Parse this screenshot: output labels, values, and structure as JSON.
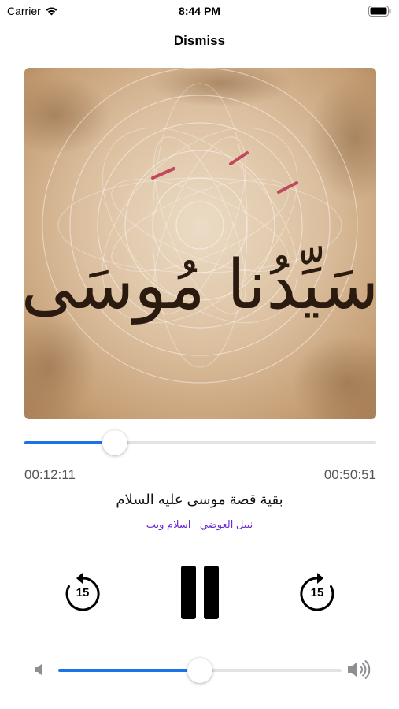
{
  "status_bar": {
    "carrier": "Carrier",
    "time": "8:44 PM"
  },
  "header": {
    "dismiss_label": "Dismiss"
  },
  "artwork": {
    "calligraphy_text": "سَيِّدُنا مُوسَى"
  },
  "playback": {
    "elapsed": "00:12:11",
    "duration": "00:50:51",
    "progress_fraction": 0.257
  },
  "track": {
    "title": "بقية قصة موسى عليه السلام",
    "subtitle": "نبيل العوضي - اسلام ويب",
    "subtitle_color": "#6c2bd6"
  },
  "controls": {
    "skip_back_seconds": "15",
    "skip_forward_seconds": "15",
    "state_icon": "pause-icon"
  },
  "volume": {
    "level_fraction": 0.5
  },
  "colors": {
    "accent": "#1a74e8",
    "track_bg": "#e3e3e6"
  }
}
